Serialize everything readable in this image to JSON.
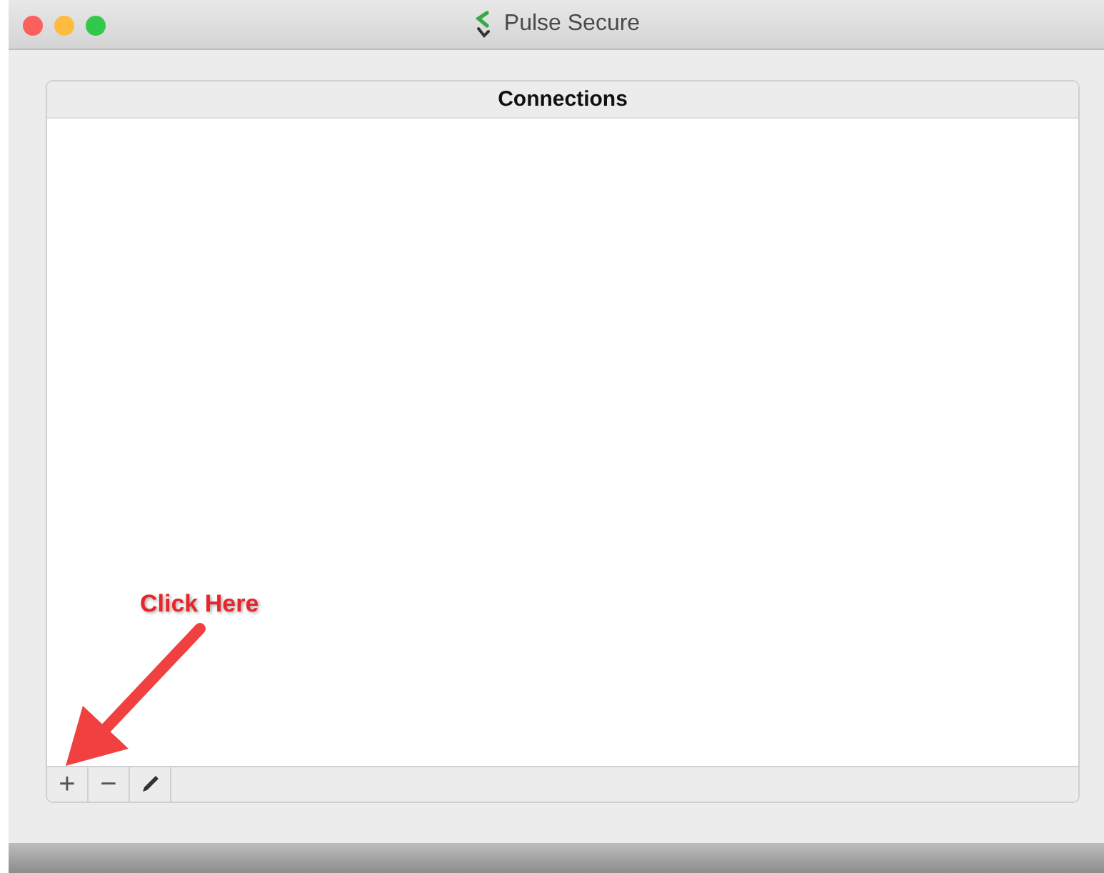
{
  "window": {
    "title": "Pulse Secure"
  },
  "connections": {
    "title": "Connections"
  },
  "toolbar": [
    {
      "kind": "glyph",
      "label": "+"
    },
    {
      "kind": "glyph",
      "label": "−"
    },
    {
      "kind": "edit"
    }
  ],
  "annotation": {
    "text": "Click Here"
  }
}
